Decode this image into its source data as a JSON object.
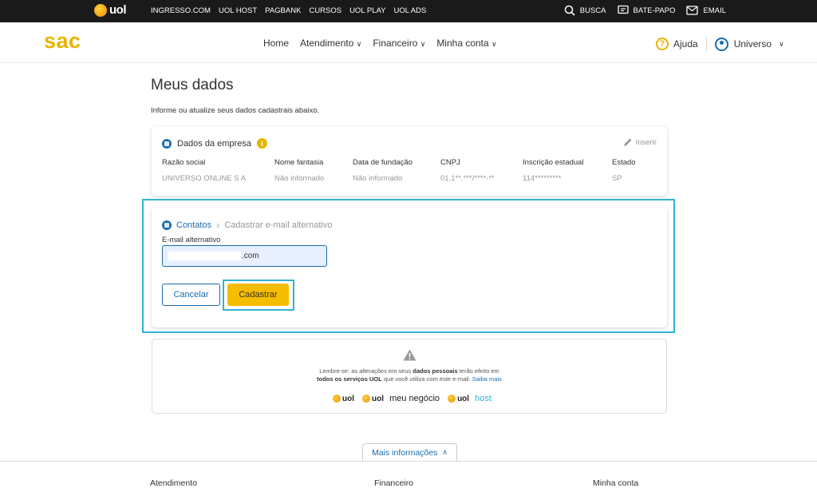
{
  "topbar": {
    "logo": "uol",
    "links": [
      "INGRESSO.COM",
      "UOL HOST",
      "PAGBANK",
      "CURSOS",
      "UOL PLAY",
      "UOL ADS"
    ],
    "busca": "BUSCA",
    "bate_papo": "BATE-PAPO",
    "email": "EMAIL"
  },
  "nav": {
    "brand": "sac",
    "home": "Home",
    "atendimento": "Atendimento",
    "financeiro": "Financeiro",
    "minha_conta": "Minha conta",
    "ajuda": "Ajuda",
    "user": "Universo"
  },
  "page": {
    "title": "Meus dados",
    "subtitle": "Informe ou atualize seus dados cadastrais abaixo."
  },
  "empresa": {
    "title": "Dados da empresa",
    "inserir": "Inserir",
    "columns": [
      {
        "h": "Razão social",
        "v": "UNIVERSO ONLINE S A"
      },
      {
        "h": "Nome fantasia",
        "v": "Não informado"
      },
      {
        "h": "Data de fundação",
        "v": "Não informado"
      },
      {
        "h": "CNPJ",
        "v": "01.1**.***/****-**"
      },
      {
        "h": "Inscrição estadual",
        "v": "114*********"
      },
      {
        "h": "Estado",
        "v": "SP"
      }
    ]
  },
  "contatos": {
    "crumb_a": "Contatos",
    "crumb_b": "Cadastrar e-mail alternativo",
    "field_label": "E-mail alternativo",
    "field_value": ".com",
    "cancel": "Cancelar",
    "submit": "Cadastrar"
  },
  "notice": {
    "line1_a": "Lembre-se: as alterações em seus ",
    "line1_b": "dados pessoais",
    "line1_c": " terão efeito em",
    "line2_a": "todos os serviços UOL",
    "line2_b": " que você utiliza com este e-mail. ",
    "link": "Saiba mais",
    "brand1": "uol",
    "brand2_u": "uol",
    "brand2_x": "meu negócio",
    "brand3_u": "uol",
    "brand3_x": "host"
  },
  "footer": {
    "more": "Mais informações",
    "atendimento": "Atendimento",
    "financeiro": "Financeiro",
    "minha_conta": "Minha conta"
  }
}
